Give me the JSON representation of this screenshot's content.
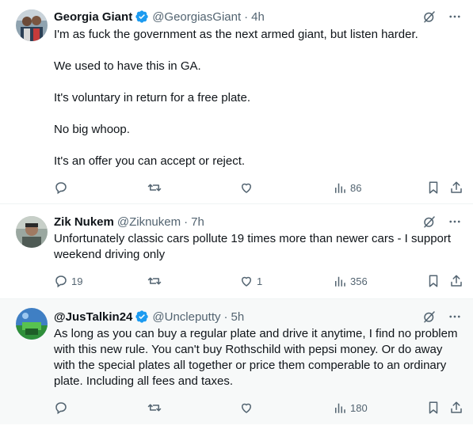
{
  "tweets": [
    {
      "name": "Georgia Giant",
      "verified": true,
      "handle": "@GeorgiasGiant",
      "dot": "·",
      "time": "4h",
      "text": [
        "I'm as fuck the government as the next armed giant, but listen harder.",
        "We used to have this in GA.",
        "It's voluntary in return for a free plate.",
        "No big whoop.",
        "It's an offer you can accept or reject."
      ],
      "replies": "",
      "retweets": "",
      "likes": "",
      "views": "86"
    },
    {
      "name": "Zik Nukem",
      "verified": false,
      "handle": "@Ziknukem",
      "dot": "·",
      "time": "7h",
      "text": "Unfortunately classic cars pollute 19 times more than newer cars - I support weekend driving only",
      "replies": "19",
      "retweets": "",
      "likes": "1",
      "views": "356"
    },
    {
      "name": "@JusTalkin24",
      "verified": true,
      "handle": "@Uncleputty",
      "dot": "·",
      "time": "5h",
      "text": "As long as you can buy a regular plate and drive it anytime, I find no problem with this new rule. You can't buy Rothschild with pepsi money. Or do away with the special plates all together or price them comperable to an ordinary plate. Including all fees and taxes.",
      "replies": "",
      "retweets": "",
      "likes": "",
      "views": "180"
    }
  ],
  "colors": {
    "verified": "#1d9bf0",
    "text": "#0f1419",
    "muted": "#536471",
    "highlight_bg": "#f7f9f9",
    "divider": "#eff3f4"
  },
  "icons": [
    "verified-badge-icon",
    "grok-icon",
    "more-icon",
    "reply-icon",
    "retweet-icon",
    "like-icon",
    "views-icon",
    "bookmark-icon",
    "share-icon"
  ]
}
